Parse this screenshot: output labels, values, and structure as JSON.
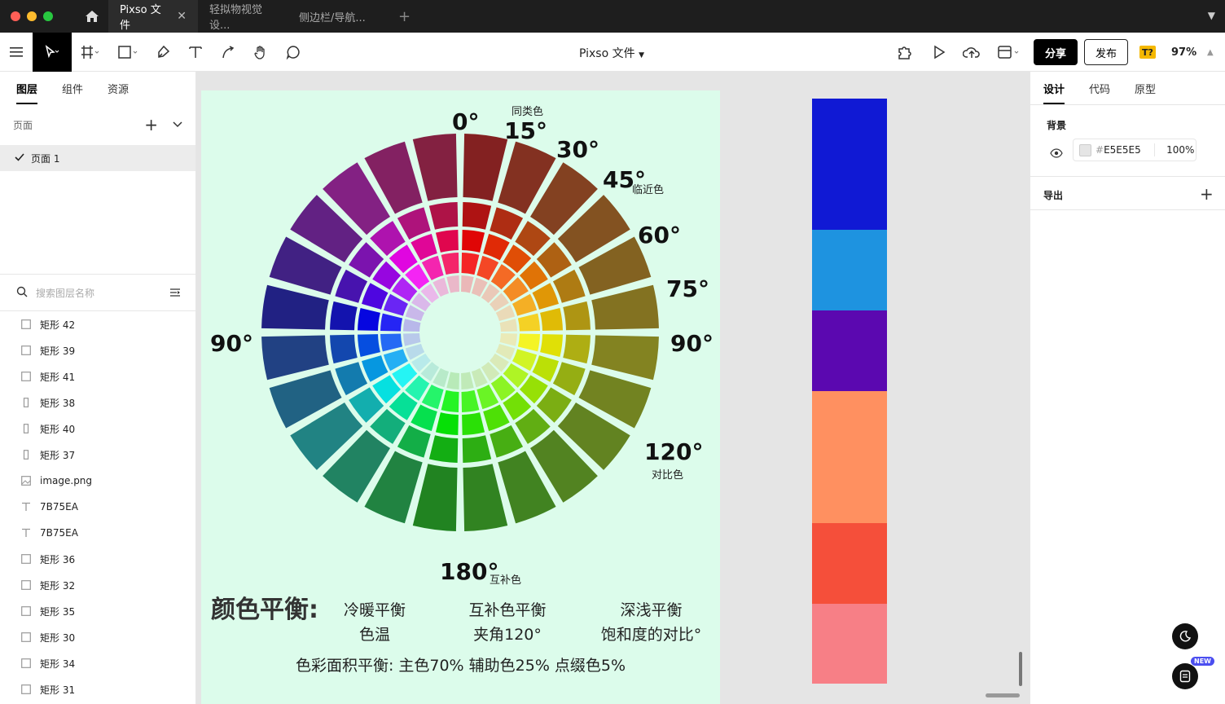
{
  "titlebar": {
    "tabs": [
      {
        "label": "Pixso 文件",
        "active": true
      },
      {
        "label": "轻拟物视觉设...",
        "active": false
      },
      {
        "label": "侧边栏/导航...",
        "active": false
      }
    ]
  },
  "toolbar": {
    "doc_title": "Pixso 文件",
    "share_label": "分享",
    "publish_label": "发布",
    "font_badge": "T?",
    "zoom": "97%"
  },
  "left_panel": {
    "tabs": [
      "图层",
      "组件",
      "资源"
    ],
    "pages_label": "页面",
    "page_item": "页面 1",
    "search_placeholder": "搜索图层名称",
    "layers": [
      {
        "name": "矩形 42",
        "icon": "rect-icon"
      },
      {
        "name": "矩形 39",
        "icon": "rect-icon"
      },
      {
        "name": "矩形 41",
        "icon": "rect-icon"
      },
      {
        "name": "矩形 38",
        "icon": "thin-rect-icon"
      },
      {
        "name": "矩形 40",
        "icon": "thin-rect-icon"
      },
      {
        "name": "矩形 37",
        "icon": "thin-rect-icon"
      },
      {
        "name": "image.png",
        "icon": "image-icon"
      },
      {
        "name": "7B75EA",
        "icon": "text-icon"
      },
      {
        "name": "7B75EA",
        "icon": "text-icon"
      },
      {
        "name": "矩形 36",
        "icon": "rect-icon"
      },
      {
        "name": "矩形 32",
        "icon": "rect-icon"
      },
      {
        "name": "矩形 35",
        "icon": "rect-icon"
      },
      {
        "name": "矩形 30",
        "icon": "rect-icon"
      },
      {
        "name": "矩形 34",
        "icon": "rect-icon"
      },
      {
        "name": "矩形 31",
        "icon": "rect-icon"
      }
    ]
  },
  "right_panel": {
    "tabs": [
      "设计",
      "代码",
      "原型"
    ],
    "background_label": "背景",
    "hash": "#",
    "bg_color": "E5E5E5",
    "bg_opacity": "100%",
    "export_label": "导出"
  },
  "artboard": {
    "angles": {
      "a0": "0°",
      "a15": "15°",
      "a30": "30°",
      "a45": "45°",
      "a60": "60°",
      "a75": "75°",
      "a90r": "90°",
      "a90l": "90°",
      "a120": "120°",
      "a180": "180°"
    },
    "notes": {
      "analog": "同类色",
      "adjacent": "临近色",
      "contrast": "对比色",
      "complement": "互补色"
    },
    "balance_title": "颜色平衡:",
    "balance_items": [
      {
        "title": "冷暖平衡",
        "sub": "色温"
      },
      {
        "title": "互补色平衡",
        "sub": "夹角120°"
      },
      {
        "title": "深浅平衡",
        "sub": "饱和度的对比°"
      }
    ],
    "area_balance": "色彩面积平衡: 主色70% 辅助色25% 点缀色5%",
    "colors": {
      "artboard_bg": "#dcfceb",
      "swatches": [
        "#1019d4",
        "#1e93e0",
        "#5b08b0",
        "#ff9060",
        "#f54f3a",
        "#f77f86"
      ],
      "swatch_weights": [
        161,
        99,
        99,
        162,
        99,
        98
      ]
    }
  }
}
